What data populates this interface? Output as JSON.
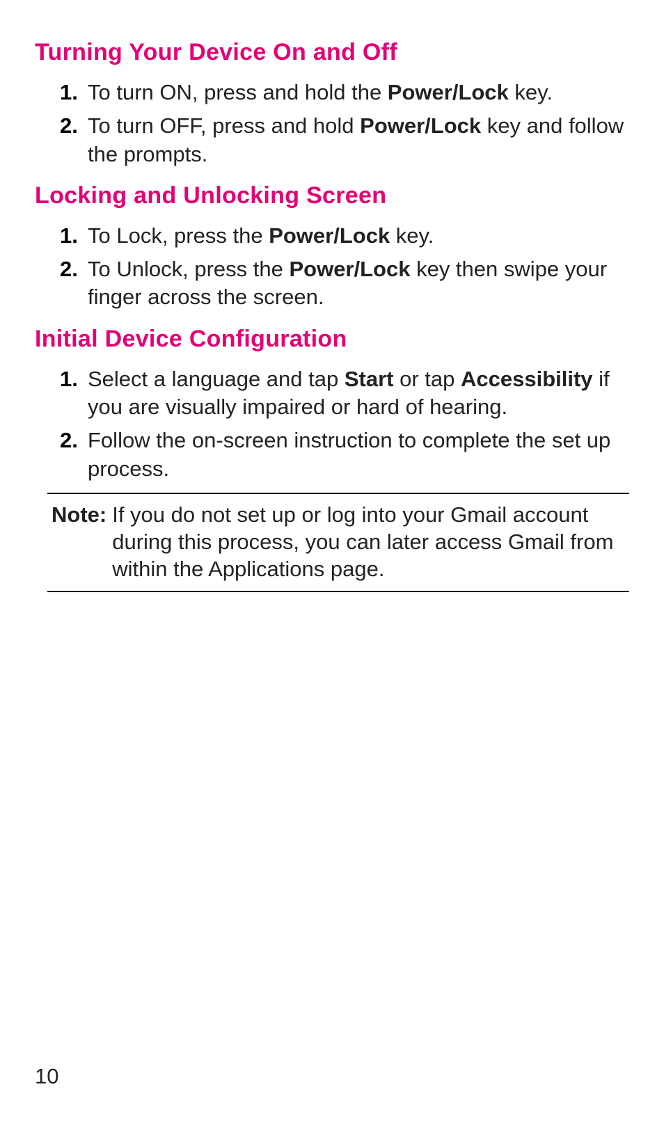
{
  "sections": [
    {
      "heading": "Turning Your Device On and Off",
      "items": [
        {
          "pre": "To turn ON, press and hold the ",
          "bold": "Power/Lock",
          "post": " key."
        },
        {
          "pre": "To turn OFF, press and hold ",
          "bold": "Power/Lock",
          "post": " key and follow the prompts."
        }
      ]
    },
    {
      "heading": "Locking and Unlocking Screen",
      "items": [
        {
          "pre": "To Lock, press the ",
          "bold": "Power/Lock",
          "post": " key."
        },
        {
          "pre": "To Unlock, press the ",
          "bold": "Power/Lock",
          "post": " key then swipe your finger across the screen."
        }
      ]
    },
    {
      "heading": "Initial Device Configuration",
      "items": [
        {
          "pre": "Select a language and tap ",
          "bold": "Start",
          "post": " or tap ",
          "bold2": "Accessibility",
          "post2": " if you are visually impaired or hard of hearing."
        },
        {
          "pre": "Follow the on-screen instruction to complete the set up process.",
          "bold": "",
          "post": ""
        }
      ]
    }
  ],
  "note": {
    "label": "Note:",
    "text": "If you do not set up or log into your Gmail account during this process, you can later access Gmail from within the Applications page."
  },
  "page_number": "10"
}
